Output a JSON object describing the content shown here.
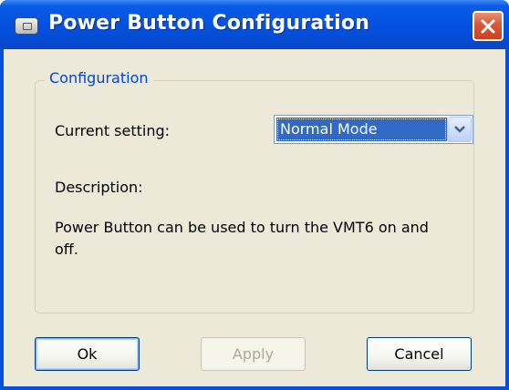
{
  "window": {
    "title": "Power Button Configuration",
    "icon": "power-button-app-icon",
    "close_icon": "close-icon"
  },
  "group": {
    "title": "Configuration"
  },
  "current_setting": {
    "label": "Current setting:",
    "value": "Normal Mode",
    "dropdown_icon": "chevron-down-icon"
  },
  "description": {
    "label": "Description:",
    "text": "Power Button can be used to turn the VMT6 on and off."
  },
  "buttons": {
    "ok": "Ok",
    "apply": "Apply",
    "cancel": "Cancel"
  },
  "colors": {
    "titlebar": "#0553e0",
    "dialog_bg": "#ece9d8",
    "group_title": "#0046d5",
    "selection": "#316ac5",
    "close_button": "#d9573a"
  }
}
